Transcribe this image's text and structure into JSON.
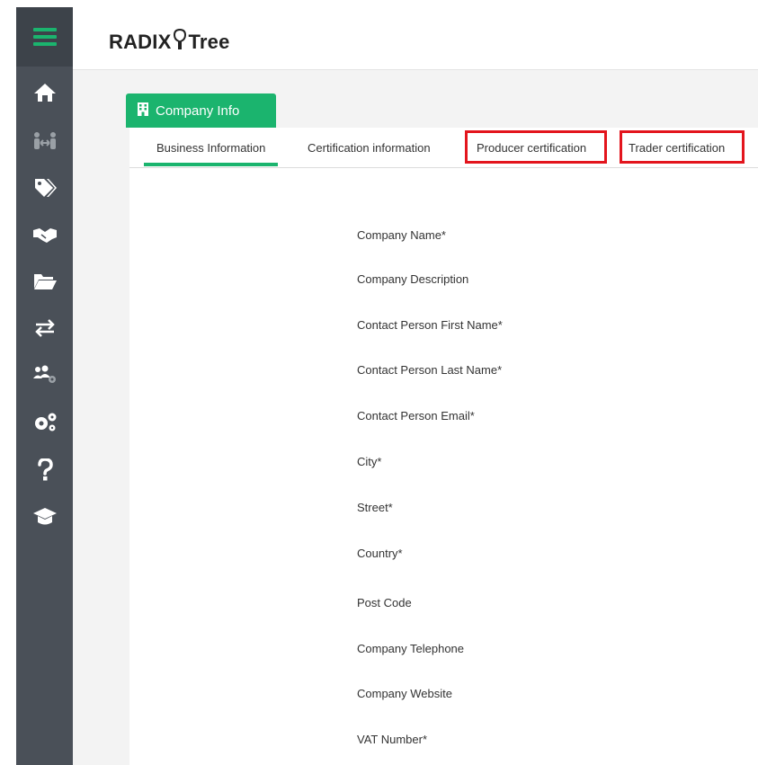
{
  "app": {
    "logo_left": "RADIX",
    "logo_right": "Tree",
    "accent_color": "#1bb46e",
    "sidebar_color": "#4a5058",
    "highlight_color": "#e3151d"
  },
  "sidebar": {
    "items": [
      {
        "icon": "menu-icon"
      },
      {
        "icon": "home-icon"
      },
      {
        "icon": "transfer-people-icon"
      },
      {
        "icon": "tags-icon"
      },
      {
        "icon": "handshake-icon"
      },
      {
        "icon": "folder-icon"
      },
      {
        "icon": "exchange-arrows-icon"
      },
      {
        "icon": "users-settings-icon"
      },
      {
        "icon": "gears-icon"
      },
      {
        "icon": "help-icon"
      },
      {
        "icon": "graduation-cap-icon"
      }
    ]
  },
  "page": {
    "section_tab": "Company Info",
    "tabs": [
      {
        "label": "Business Information",
        "active": true
      },
      {
        "label": "Certification information",
        "active": false
      },
      {
        "label": "Producer certification",
        "active": false,
        "highlighted": true
      },
      {
        "label": "Trader certification",
        "active": false,
        "highlighted": true
      }
    ]
  },
  "form": {
    "fields": [
      "Company Name*",
      "Company Description",
      "Contact Person First Name*",
      "Contact Person Last Name*",
      "Contact Person Email*",
      "City*",
      "Street*",
      "Country*",
      "Post Code",
      "Company Telephone",
      "Company Website",
      "VAT Number*"
    ]
  }
}
